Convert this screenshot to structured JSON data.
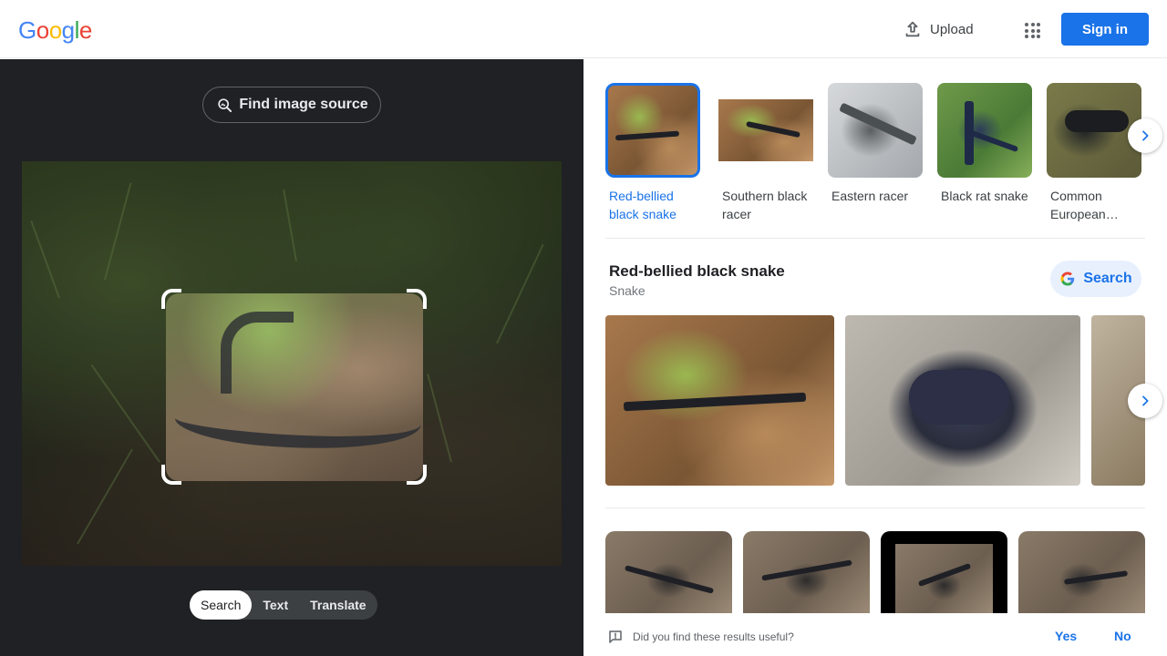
{
  "header": {
    "logo_letters": [
      {
        "char": "G",
        "color": "#4285f4"
      },
      {
        "char": "o",
        "color": "#ea4335"
      },
      {
        "char": "o",
        "color": "#fbbc05"
      },
      {
        "char": "g",
        "color": "#4285f4"
      },
      {
        "char": "l",
        "color": "#34a853"
      },
      {
        "char": "e",
        "color": "#ea4335"
      }
    ],
    "upload_label": "Upload",
    "sign_in_label": "Sign in"
  },
  "lens": {
    "find_source_label": "Find image source",
    "modes": [
      "Search",
      "Text",
      "Translate"
    ],
    "active_mode": "Search"
  },
  "results": {
    "chips": [
      {
        "label": "Red-bellied black snake",
        "selected": true
      },
      {
        "label": "Southern black racer",
        "selected": false
      },
      {
        "label": "Eastern racer",
        "selected": false
      },
      {
        "label": "Black rat snake",
        "selected": false
      },
      {
        "label": "Common European…",
        "selected": false
      }
    ],
    "entity": {
      "title": "Red-bellied black snake",
      "subtitle": "Snake",
      "search_label": "Search"
    },
    "feedback": {
      "question": "Did you find these results useful?",
      "yes": "Yes",
      "no": "No"
    }
  },
  "colors": {
    "accent": "#1a73e8",
    "dark_bg": "#202124"
  }
}
